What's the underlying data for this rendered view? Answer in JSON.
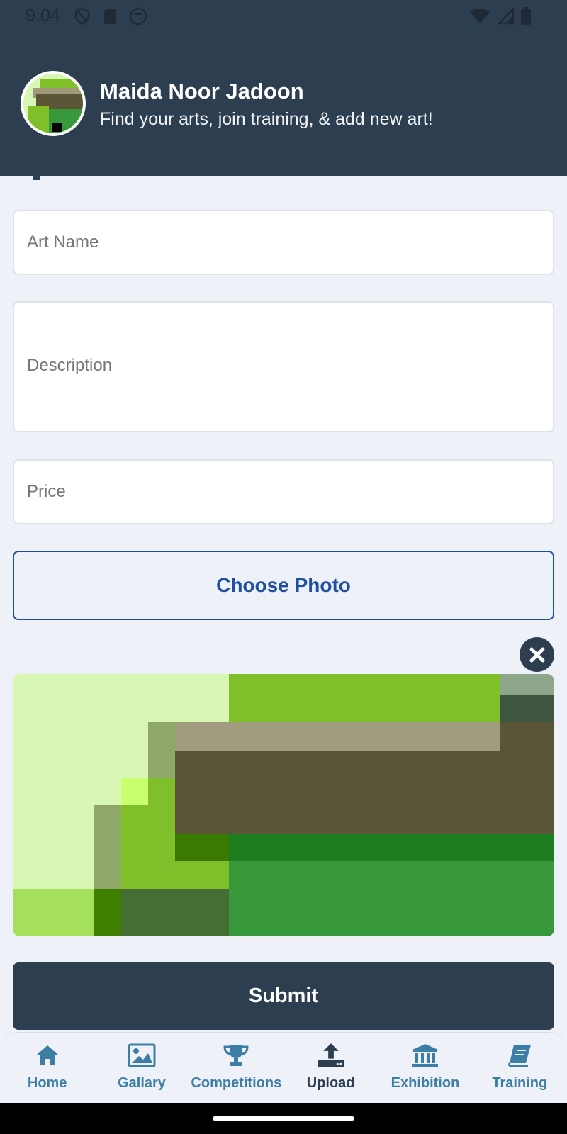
{
  "status_bar": {
    "time": "9:04"
  },
  "header": {
    "user_name": "Maida Noor Jadoon",
    "subtitle": "Find your arts, join training, & add new art!"
  },
  "form": {
    "art_name_placeholder": "Art Name",
    "description_placeholder": "Description",
    "price_placeholder": "Price",
    "choose_photo_label": "Choose Photo",
    "submit_label": "Submit"
  },
  "bottom_nav": {
    "items": [
      {
        "label": "Home",
        "icon": "home-icon"
      },
      {
        "label": "Gallary",
        "icon": "image-icon"
      },
      {
        "label": "Competitions",
        "icon": "trophy-icon"
      },
      {
        "label": "Upload",
        "icon": "upload-icon",
        "active": true
      },
      {
        "label": "Exhibition",
        "icon": "museum-icon"
      },
      {
        "label": "Training",
        "icon": "book-icon"
      }
    ]
  },
  "colors": {
    "header_bg": "#2c3e50",
    "accent_blue": "#1f4fa0",
    "nav_inactive": "#3d7ea6",
    "page_bg": "#eef1f7"
  }
}
